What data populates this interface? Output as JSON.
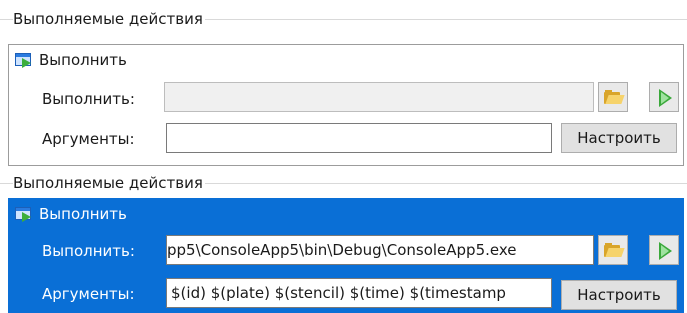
{
  "groups": [
    {
      "title": "Выполняемые действия",
      "item": {
        "title": "Выполнить",
        "selected": false,
        "execute_label": "Выполнить:",
        "execute_value": "",
        "arguments_label": "Аргументы:",
        "arguments_value": "",
        "configure_label": "Настроить"
      }
    },
    {
      "title": "Выполняемые действия",
      "item": {
        "title": "Выполнить",
        "selected": true,
        "execute_label": "Выполнить:",
        "execute_value": "pp5\\ConsoleApp5\\bin\\Debug\\ConsoleApp5.exe",
        "arguments_label": "Аргументы:",
        "arguments_value": "$(id) $(plate) $(stencil) $(time) $(timestamp",
        "configure_label": "Настроить"
      }
    }
  ],
  "icons": {
    "action": "run-action-icon",
    "browse": "folder-open-icon",
    "run": "play-icon"
  },
  "colors": {
    "selected_background": "#0a6fd6",
    "panel_border": "#9c9c9c",
    "play_green": "#3aa83a",
    "folder_yellow": "#f6d36b"
  }
}
